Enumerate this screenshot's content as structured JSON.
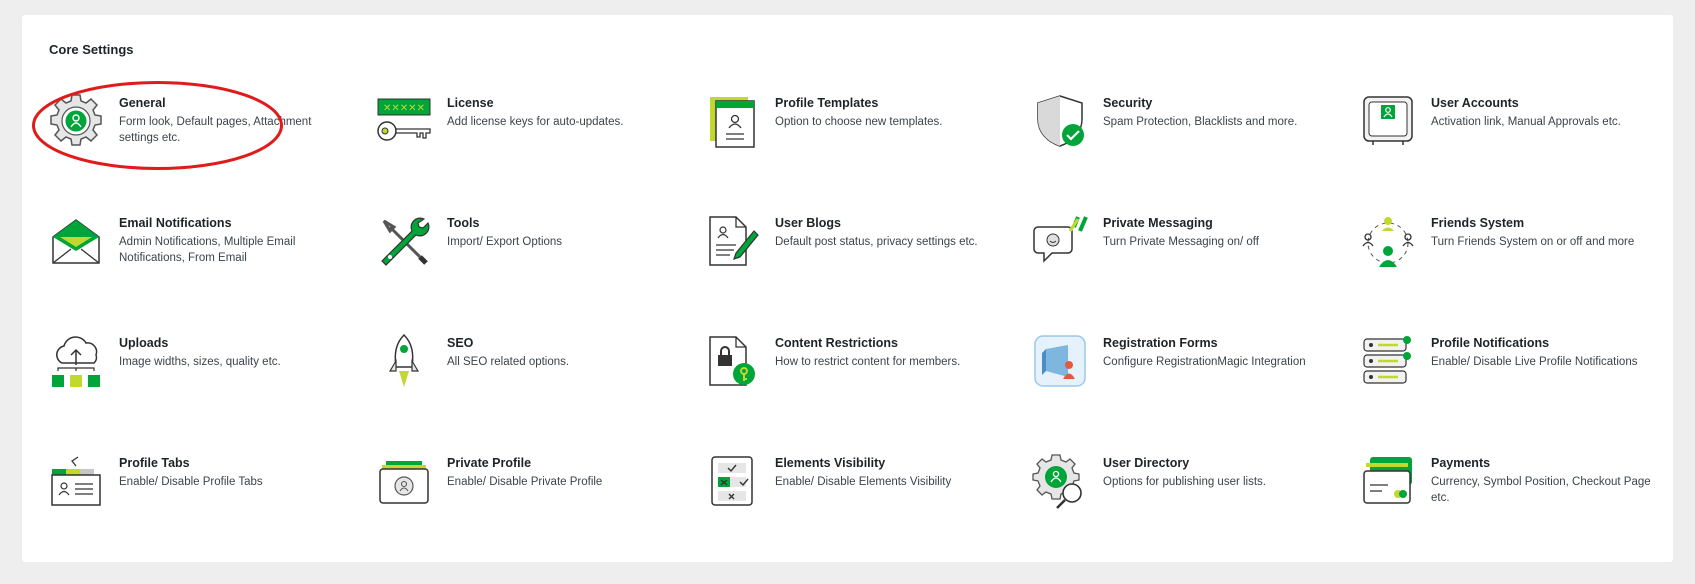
{
  "section": {
    "title": "Core Settings"
  },
  "colors": {
    "accent": "#00a539",
    "lime": "#c1d82f",
    "annotation": "#e01b1b"
  },
  "items": [
    {
      "title": "General",
      "desc": "Form look, Default pages, Attachment settings etc.",
      "icon": "gear-user-icon"
    },
    {
      "title": "License",
      "desc": "Add license keys for auto-updates.",
      "icon": "license-key-icon"
    },
    {
      "title": "Profile Templates",
      "desc": "Option to choose new templates.",
      "icon": "profile-template-icon"
    },
    {
      "title": "Security",
      "desc": "Spam Protection, Blacklists and more.",
      "icon": "shield-check-icon"
    },
    {
      "title": "User Accounts",
      "desc": "Activation link, Manual Approvals etc.",
      "icon": "user-account-icon"
    },
    {
      "title": "Email Notifications",
      "desc": "Admin Notifications, Multiple Email Notifications, From Email",
      "icon": "envelope-icon"
    },
    {
      "title": "Tools",
      "desc": "Import/ Export Options",
      "icon": "tools-icon"
    },
    {
      "title": "User Blogs",
      "desc": "Default post status, privacy settings etc.",
      "icon": "blog-pen-icon"
    },
    {
      "title": "Private Messaging",
      "desc": "Turn Private Messaging on/ off",
      "icon": "chat-bubble-icon"
    },
    {
      "title": "Friends System",
      "desc": "Turn Friends System on or off and more",
      "icon": "friends-network-icon"
    },
    {
      "title": "Uploads",
      "desc": "Image widths, sizes, quality etc.",
      "icon": "cloud-upload-icon"
    },
    {
      "title": "SEO",
      "desc": "All SEO related options.",
      "icon": "rocket-icon"
    },
    {
      "title": "Content Restrictions",
      "desc": "How to restrict content for members.",
      "icon": "locked-document-icon"
    },
    {
      "title": "Registration Forms",
      "desc": "Configure RegistrationMagic Integration",
      "icon": "registration-magic-icon"
    },
    {
      "title": "Profile Notifications",
      "desc": "Enable/ Disable Live Profile Notifications",
      "icon": "notification-list-icon"
    },
    {
      "title": "Profile Tabs",
      "desc": "Enable/ Disable Profile Tabs",
      "icon": "profile-tabs-icon"
    },
    {
      "title": "Private Profile",
      "desc": "Enable/ Disable Private Profile",
      "icon": "private-profile-icon"
    },
    {
      "title": "Elements Visibility",
      "desc": "Enable/ Disable Elements Visibility",
      "icon": "checklist-icon"
    },
    {
      "title": "User Directory",
      "desc": "Options for publishing user lists.",
      "icon": "user-search-icon"
    },
    {
      "title": "Payments",
      "desc": "Currency, Symbol Position, Checkout Page etc.",
      "icon": "credit-card-icon"
    }
  ]
}
